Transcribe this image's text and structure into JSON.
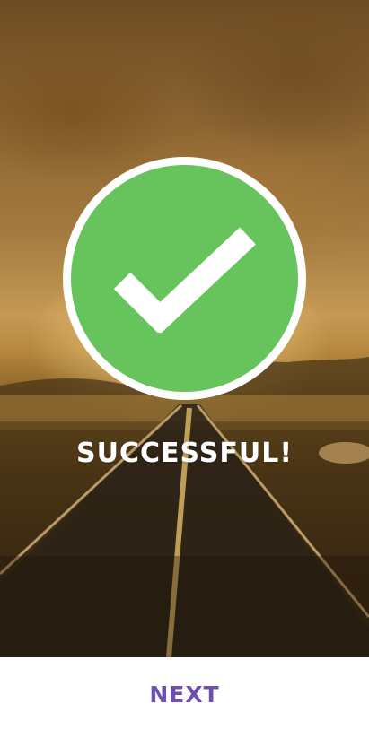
{
  "status": {
    "title": "SUCCESSFUL!",
    "icon": "checkmark-circle-icon",
    "icon_color": "#67c35c"
  },
  "footer": {
    "next_label": "NEXT",
    "next_color": "#6f4fae"
  },
  "background": {
    "image": "sunset-desert-road"
  }
}
